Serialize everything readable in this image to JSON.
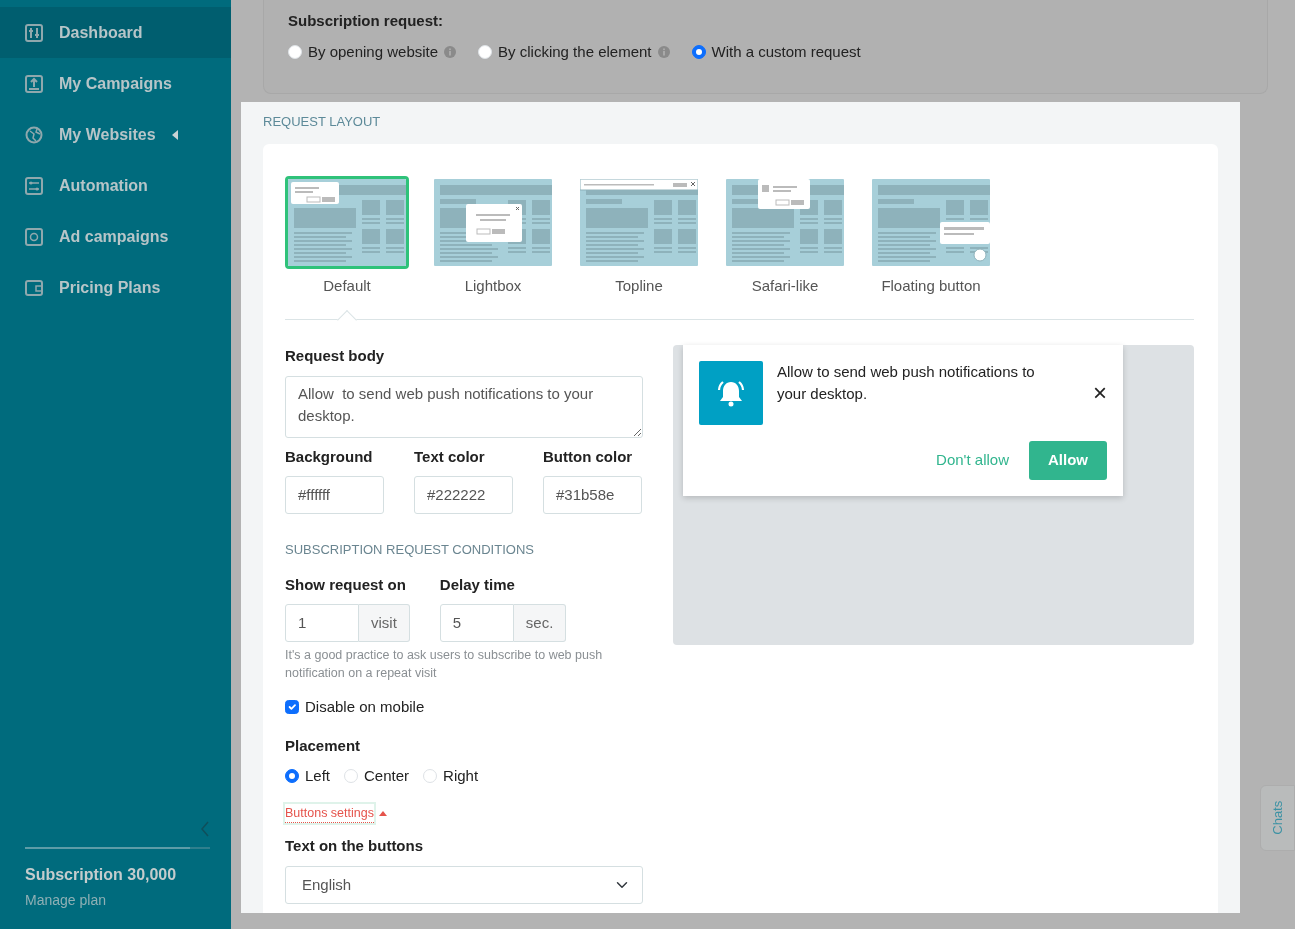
{
  "sidebar": {
    "items": [
      {
        "label": "Dashboard",
        "selected": true,
        "has_submenu": false
      },
      {
        "label": "My Campaigns",
        "selected": false,
        "has_submenu": false
      },
      {
        "label": "My Websites",
        "selected": false,
        "has_submenu": true
      },
      {
        "label": "Automation",
        "selected": false,
        "has_submenu": false
      },
      {
        "label": "Ad campaigns",
        "selected": false,
        "has_submenu": false
      },
      {
        "label": "Pricing Plans",
        "selected": false,
        "has_submenu": false
      }
    ],
    "subscription": {
      "title": "Subscription 30,000",
      "link": "Manage plan",
      "level": 0.89
    }
  },
  "subscription_request": {
    "label": "Subscription request:",
    "options": [
      {
        "label": "By opening website",
        "info": true,
        "selected": false
      },
      {
        "label": "By clicking the element",
        "info": true,
        "selected": false
      },
      {
        "label": "With a custom request",
        "info": false,
        "selected": true
      }
    ]
  },
  "request_layout": {
    "title": "REQUEST LAYOUT",
    "options": [
      {
        "label": "Default",
        "selected": true
      },
      {
        "label": "Lightbox",
        "selected": false
      },
      {
        "label": "Topline",
        "selected": false
      },
      {
        "label": "Safari-like",
        "selected": false
      },
      {
        "label": "Floating button",
        "selected": false
      }
    ]
  },
  "request_body": {
    "label": "Request body",
    "value": "Allow  to send web push notifications to your desktop."
  },
  "colors": [
    {
      "label": "Background",
      "value": "#ffffff"
    },
    {
      "label": "Text color",
      "value": "#222222"
    },
    {
      "label": "Button color",
      "value": "#31b58e"
    }
  ],
  "conditions": {
    "title": "SUBSCRIPTION REQUEST CONDITIONS",
    "fields": [
      {
        "label": "Show request on",
        "value": "1",
        "unit": "visit"
      },
      {
        "label": "Delay time",
        "value": "5",
        "unit": "sec."
      }
    ],
    "hint": "It's a good practice to ask users to subscribe to web push notification on a repeat visit"
  },
  "disable_on_mobile": {
    "label": "Disable on mobile",
    "checked": true
  },
  "placement": {
    "label": "Placement",
    "options": [
      {
        "label": "Left",
        "selected": true
      },
      {
        "label": "Center",
        "selected": false
      },
      {
        "label": "Right",
        "selected": false
      }
    ]
  },
  "buttons_settings": {
    "label": "Buttons settings",
    "expanded": true
  },
  "text_on_buttons": {
    "label": "Text on the buttons",
    "value": "English"
  },
  "preview": {
    "text": "Allow to send web push notifications to your desktop.",
    "close": "×",
    "deny": "Don't allow",
    "allow": "Allow"
  },
  "chats": "Chats"
}
